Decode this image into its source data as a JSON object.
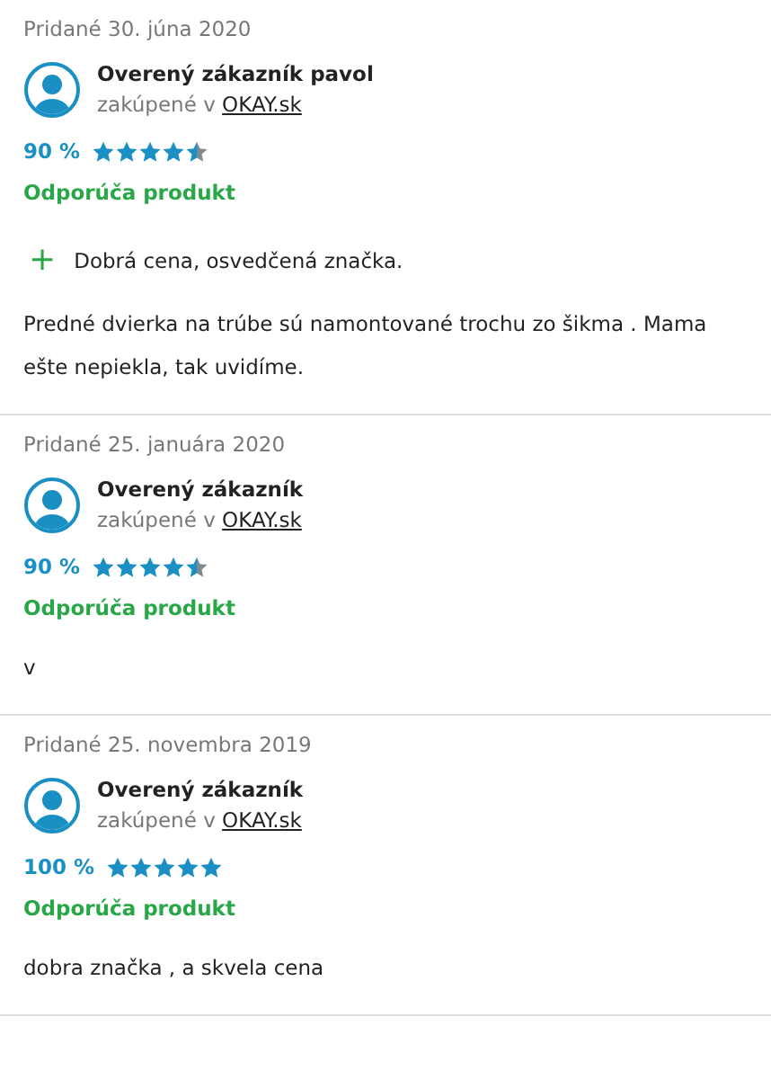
{
  "reviews": [
    {
      "date": "Pridané 30. júna 2020",
      "author": "Overený zákazník pavol",
      "purchased": "zakúpené v ",
      "shop": "OKAY.sk",
      "percent": "90 %",
      "stars": 4.5,
      "recommend": "Odporúča produkt",
      "pros": [
        {
          "icon": "+",
          "text": "Dobrá cena, osvedčená značka."
        }
      ],
      "text": "Predné dvierka na trúbe sú namontované trochu zo šikma . Mama ešte nepiekla, tak uvidíme."
    },
    {
      "date": "Pridané 25. januára 2020",
      "author": "Overený zákazník",
      "purchased": "zakúpené v ",
      "shop": "OKAY.sk",
      "percent": "90 %",
      "stars": 4.5,
      "recommend": "Odporúča produkt",
      "text": "v"
    },
    {
      "date": "Pridané 25. novembra 2019",
      "author": "Overený zákazník",
      "purchased": "zakúpené v ",
      "shop": "OKAY.sk",
      "percent": "100 %",
      "stars": 5,
      "recommend": "Odporúča produkt",
      "text": "dobra značka , a skvela cena"
    }
  ]
}
